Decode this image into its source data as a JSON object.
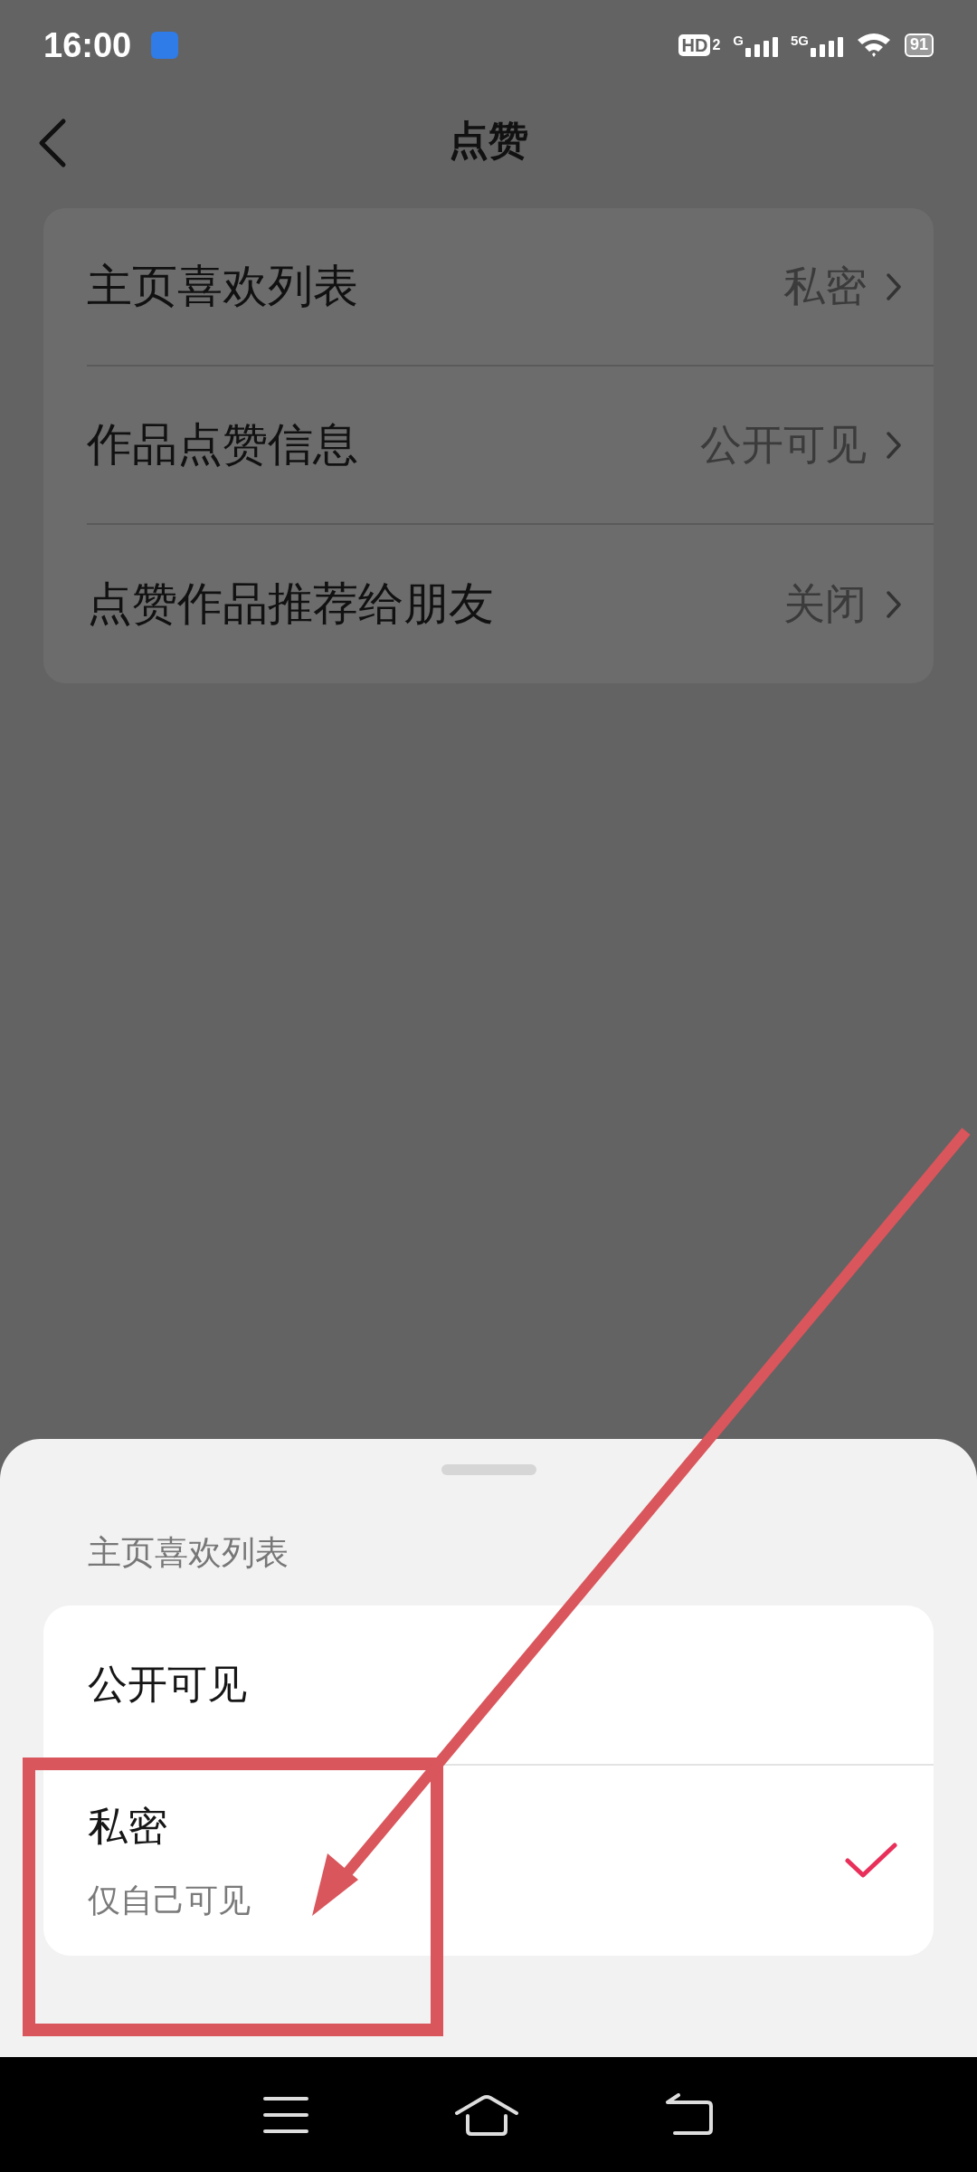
{
  "status_bar": {
    "time": "16:00",
    "network_labels": [
      "HD",
      "2",
      "G",
      "5G"
    ],
    "battery": "91"
  },
  "header": {
    "title": "点赞"
  },
  "settings": [
    {
      "label": "主页喜欢列表",
      "value": "私密"
    },
    {
      "label": "作品点赞信息",
      "value": "公开可见"
    },
    {
      "label": "点赞作品推荐给朋友",
      "value": "关闭"
    }
  ],
  "sheet": {
    "title": "主页喜欢列表",
    "options": [
      {
        "label": "公开可见",
        "selected": false
      },
      {
        "label": "私密",
        "description": "仅自己可见",
        "selected": true
      }
    ]
  }
}
